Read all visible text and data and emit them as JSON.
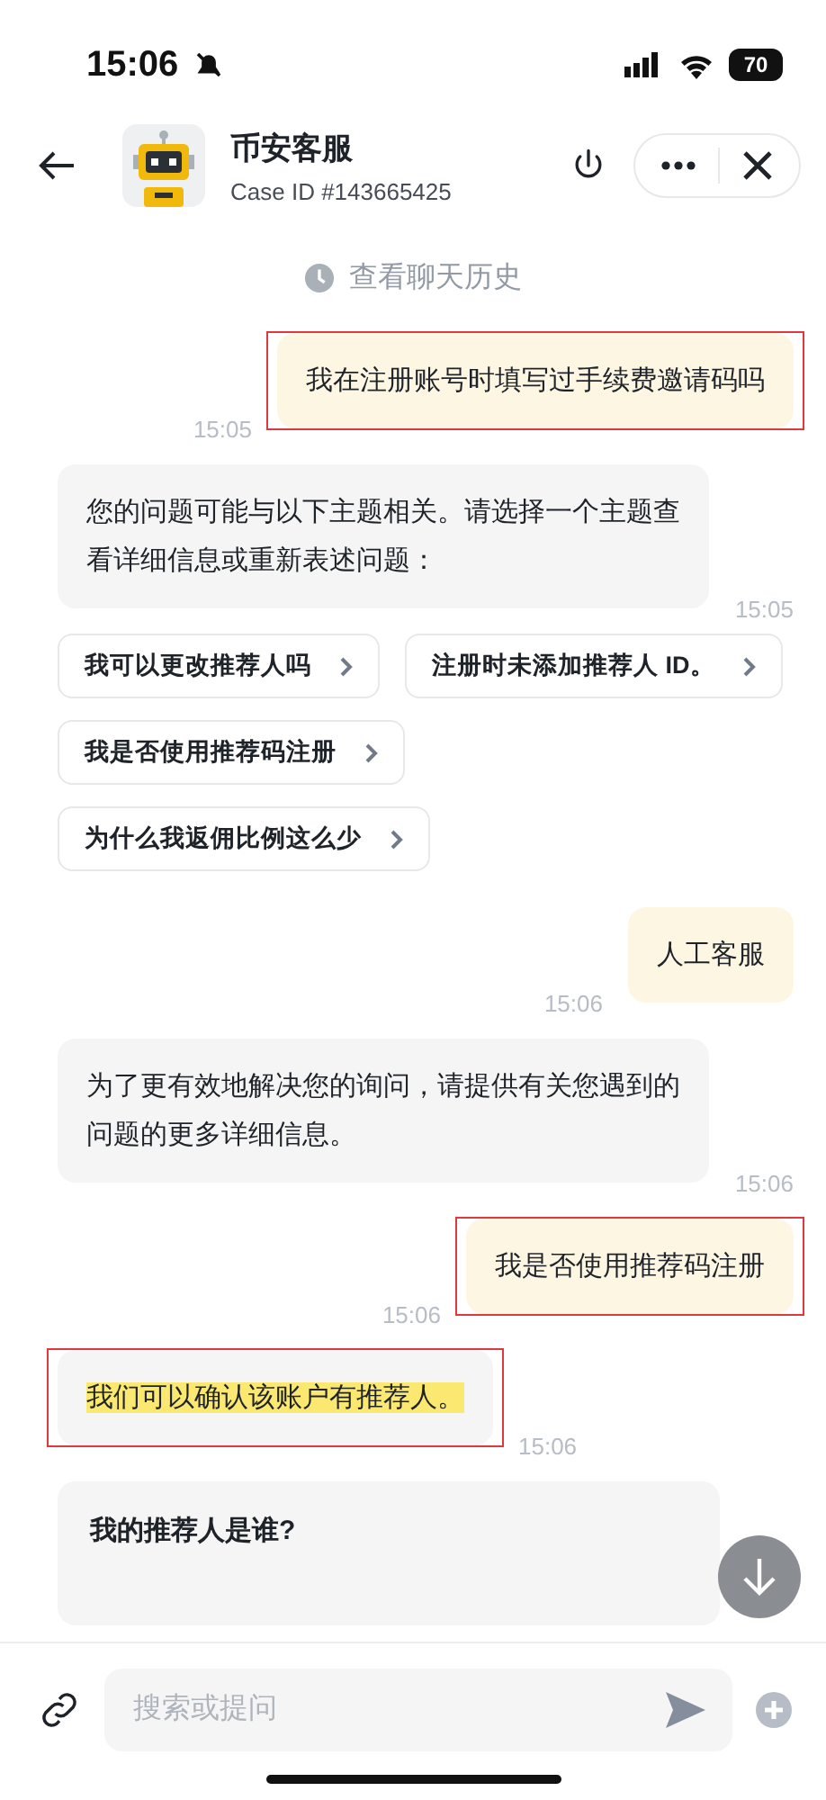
{
  "status_bar": {
    "time": "15:06",
    "battery": "70"
  },
  "header": {
    "title": "币安客服",
    "subtitle": "Case ID #143665425"
  },
  "history_link": {
    "label": "查看聊天历史"
  },
  "messages": [
    {
      "kind": "user",
      "text": "我在注册账号时填写过手续费邀请码吗",
      "time": "15:05",
      "marked": true,
      "highlighted": false
    },
    {
      "kind": "bot",
      "text": "您的问题可能与以下主题相关。请选择一个主题查看详细信息或重新表述问题：",
      "time": "15:05",
      "marked": false,
      "highlighted": false
    },
    {
      "kind": "suggestions",
      "items": [
        "我可以更改推荐人吗",
        "注册时未添加推荐人 ID。",
        "我是否使用推荐码注册",
        "为什么我返佣比例这么少"
      ]
    },
    {
      "kind": "user",
      "text": "人工客服",
      "time": "15:06",
      "marked": false,
      "highlighted": false
    },
    {
      "kind": "bot",
      "text": "为了更有效地解决您的询问，请提供有关您遇到的问题的更多详细信息。",
      "time": "15:06",
      "marked": false,
      "highlighted": false
    },
    {
      "kind": "user",
      "text": "我是否使用推荐码注册",
      "time": "15:06",
      "marked": true,
      "highlighted": false
    },
    {
      "kind": "bot",
      "text": "我们可以确认该账户有推荐人。",
      "time": "15:06",
      "marked": true,
      "highlighted": true
    },
    {
      "kind": "card",
      "title": "我的推荐人是谁?"
    }
  ],
  "composer": {
    "placeholder": "搜索或提问"
  }
}
